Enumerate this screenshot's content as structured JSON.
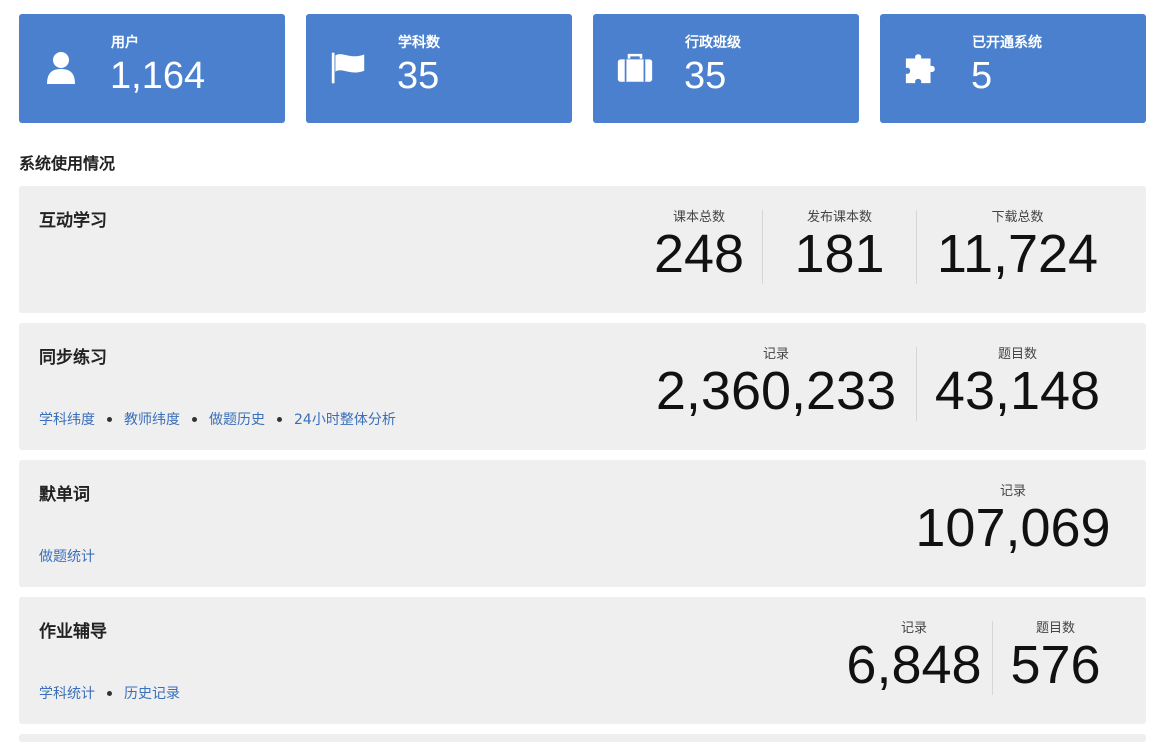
{
  "stats": [
    {
      "icon": "user-icon",
      "label": "用户",
      "value": "1,164"
    },
    {
      "icon": "flag-icon",
      "label": "学科数",
      "value": "35"
    },
    {
      "icon": "briefcase-icon",
      "label": "行政班级",
      "value": "35"
    },
    {
      "icon": "puzzle-icon",
      "label": "已开通系统",
      "value": "5"
    }
  ],
  "section_title": "系统使用情况",
  "panels": [
    {
      "title": "互动学习",
      "links": [],
      "metrics": [
        {
          "label": "课本总数",
          "value": "248"
        },
        {
          "label": "发布课本数",
          "value": "181"
        },
        {
          "label": "下载总数",
          "value": "11,724"
        }
      ]
    },
    {
      "title": "同步练习",
      "links": [
        "学科纬度",
        "教师纬度",
        "做题历史",
        "24小时整体分析"
      ],
      "metrics": [
        {
          "label": "记录",
          "value": "2,360,233"
        },
        {
          "label": "题目数",
          "value": "43,148"
        }
      ]
    },
    {
      "title": "默单词",
      "links": [
        "做题统计"
      ],
      "metrics": [
        {
          "label": "记录",
          "value": "107,069"
        }
      ]
    },
    {
      "title": "作业辅导",
      "links": [
        "学科统计",
        "历史记录"
      ],
      "metrics": [
        {
          "label": "记录",
          "value": "6,848"
        },
        {
          "label": "题目数",
          "value": "576"
        }
      ]
    }
  ],
  "colors": {
    "card": "#4a80cd",
    "panel": "#efefef",
    "link": "#3a6fba"
  }
}
